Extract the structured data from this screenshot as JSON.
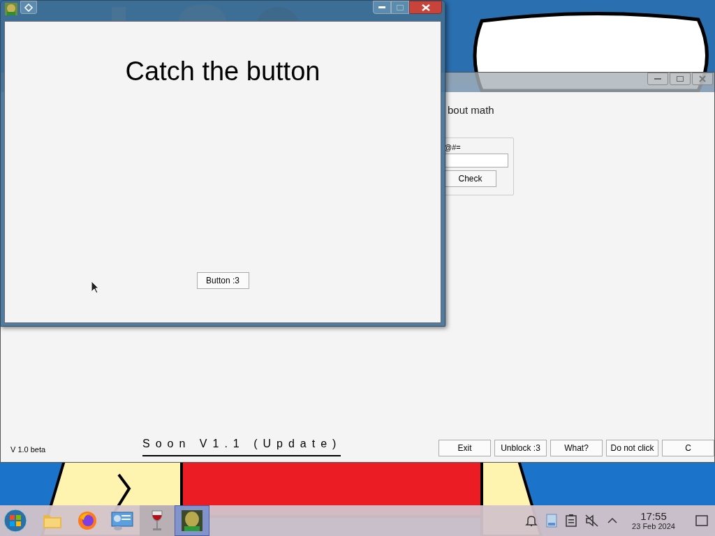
{
  "front_window": {
    "heading": "Catch the button",
    "button": "Button :3"
  },
  "back_window": {
    "partial_text": "bout math",
    "group": {
      "label": "@#=",
      "check_button": "Check"
    },
    "version": "V 1.0 beta",
    "soon_label": "Soon V1.1 (Update)",
    "buttons": [
      "Exit",
      "Unblock :3",
      "What?",
      "Do not click",
      "C"
    ]
  },
  "taskbar": {
    "apps": [
      {
        "kind": "folder",
        "selected": false,
        "running": false
      },
      {
        "kind": "browser",
        "selected": false,
        "running": false
      },
      {
        "kind": "network",
        "selected": false,
        "running": false
      },
      {
        "kind": "wine",
        "selected": false,
        "running": true
      },
      {
        "kind": "game",
        "selected": true,
        "running": true
      }
    ],
    "time": "17:55",
    "date": "23 Feb 2024"
  }
}
